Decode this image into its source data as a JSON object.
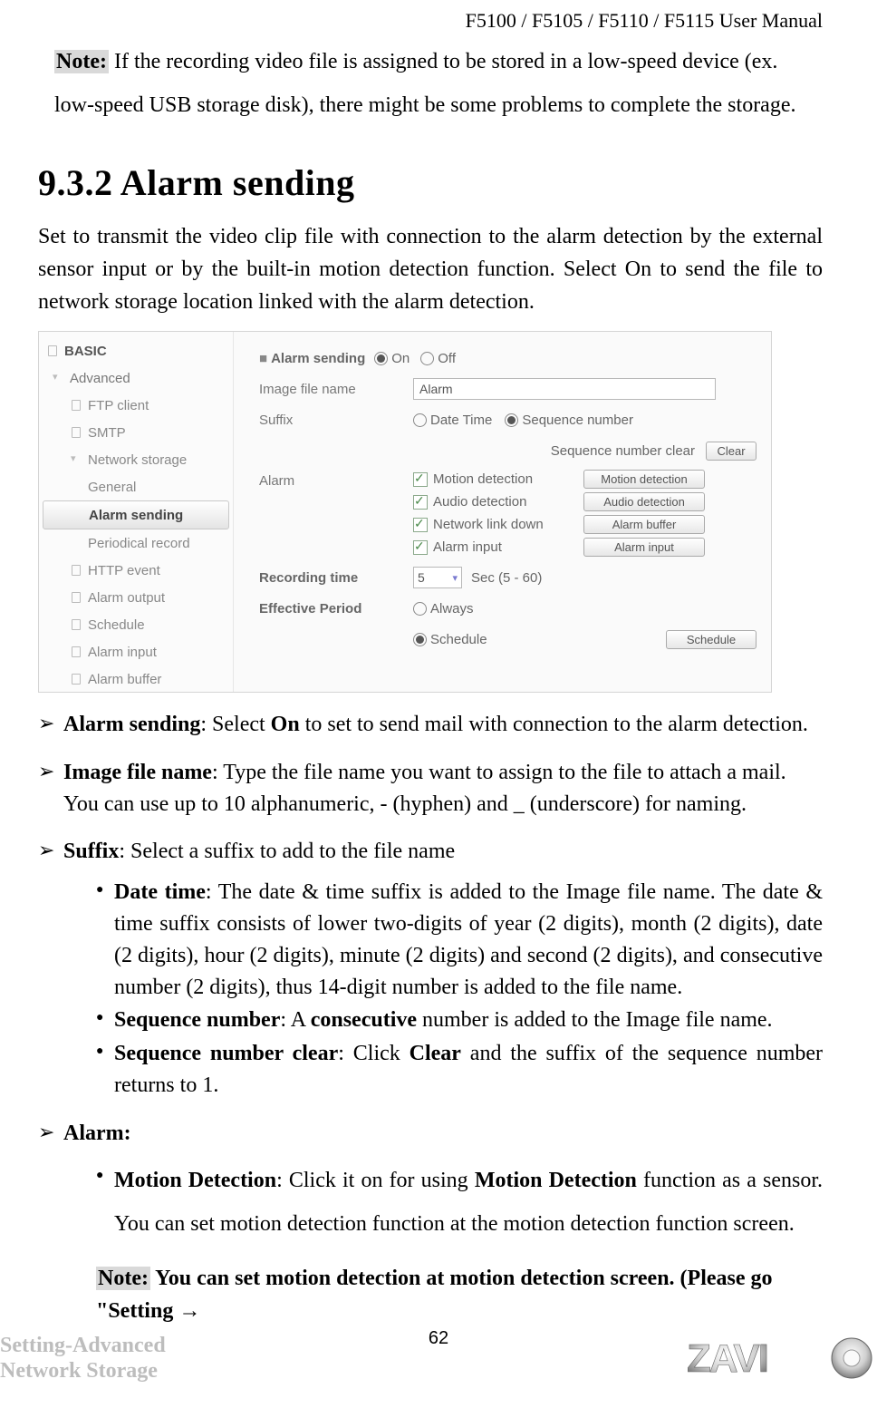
{
  "header": {
    "title": "F5100 / F5105 / F5110 / F5115 User Manual"
  },
  "note1": {
    "label": "Note:",
    "text": " If the recording video file is assigned to be stored in a low-speed device (ex. low-speed USB storage disk), there might be some problems to complete the storage."
  },
  "section": {
    "number": "9.3.2",
    "title": "Alarm sending"
  },
  "intro": "Set to transmit the video clip file with connection to the alarm detection by the external sensor input or by the built-in motion detection function. Select On to send the file to network storage location linked with the alarm detection.",
  "screenshot": {
    "nav": {
      "basic": "BASIC",
      "advanced": "Advanced",
      "items": [
        "FTP client",
        "SMTP",
        "Network storage",
        "General",
        "Alarm sending",
        "Periodical record",
        "HTTP event",
        "Alarm output",
        "Schedule",
        "Alarm input",
        "Alarm buffer"
      ]
    },
    "form": {
      "alarm_sending_label": "Alarm sending",
      "on": "On",
      "off": "Off",
      "image_file_name_label": "Image file name",
      "image_file_name_value": "Alarm",
      "suffix_label": "Suffix",
      "suffix_date_time": "Date Time",
      "suffix_seq": "Sequence number",
      "seq_clear_label": "Sequence number clear",
      "clear_btn": "Clear",
      "alarm_label": "Alarm",
      "alarm_rows": [
        {
          "text": "Motion detection",
          "btn": "Motion detection",
          "checked": true
        },
        {
          "text": "Audio detection",
          "btn": "Audio detection",
          "checked": true
        },
        {
          "text": "Network link down",
          "btn": "Alarm buffer",
          "checked": true
        },
        {
          "text": "Alarm input",
          "btn": "Alarm input",
          "checked": true
        }
      ],
      "recording_time_label": "Recording time",
      "recording_time_value": "5",
      "recording_time_hint": "Sec (5 - 60)",
      "effective_period_label": "Effective Period",
      "always": "Always",
      "schedule": "Schedule",
      "schedule_btn": "Schedule"
    }
  },
  "bullets": {
    "alarm_sending": {
      "k": "Alarm sending",
      "t": ": Select ",
      "b2": "On",
      "t2": " to set to send mail with connection to the alarm detection."
    },
    "image_file_name": {
      "k": "Image file name",
      "t": ": Type the file name you want to assign to the file to attach a mail. You can use up to 10 alphanumeric, - (hyphen) and _ (underscore) for naming."
    },
    "suffix": {
      "k": "Suffix",
      "t": ": Select a suffix to add to the file name"
    },
    "suffix_sub": {
      "date_time": {
        "k": "Date time",
        "t": ": The date & time suffix is added to the Image file name. The date & time suffix consists of lower two-digits of year (2 digits), month (2 digits), date (2 digits), hour (2 digits), minute (2 digits) and second (2 digits), and consecutive number (2 digits), thus 14-digit number is added to the file name."
      },
      "seq_num": {
        "k": "Sequence number",
        "t": ": A ",
        "b2": "consecutive",
        "t2": " number is added to the Image file name."
      },
      "seq_clear": {
        "k": "Sequence number clear",
        "t": ": Click ",
        "b2": "Clear",
        "t2": " and the suffix of the sequence number returns to 1."
      }
    },
    "alarm_h": {
      "k": "Alarm:"
    },
    "alarm_sub": {
      "motion": {
        "k": "Motion Detection",
        "t": ": Click it on for using ",
        "b2": "Motion Detection",
        "t2": " function as a sensor. You can set motion detection function at the motion detection function screen."
      }
    }
  },
  "note2": {
    "label": "Note:",
    "text": " You can set motion detection at motion detection screen. (Please go \"Setting →"
  },
  "footer": {
    "left1": "Setting-Advanced",
    "left2": "Network Storage",
    "page": "62",
    "logo_text": "ZAVIO"
  }
}
